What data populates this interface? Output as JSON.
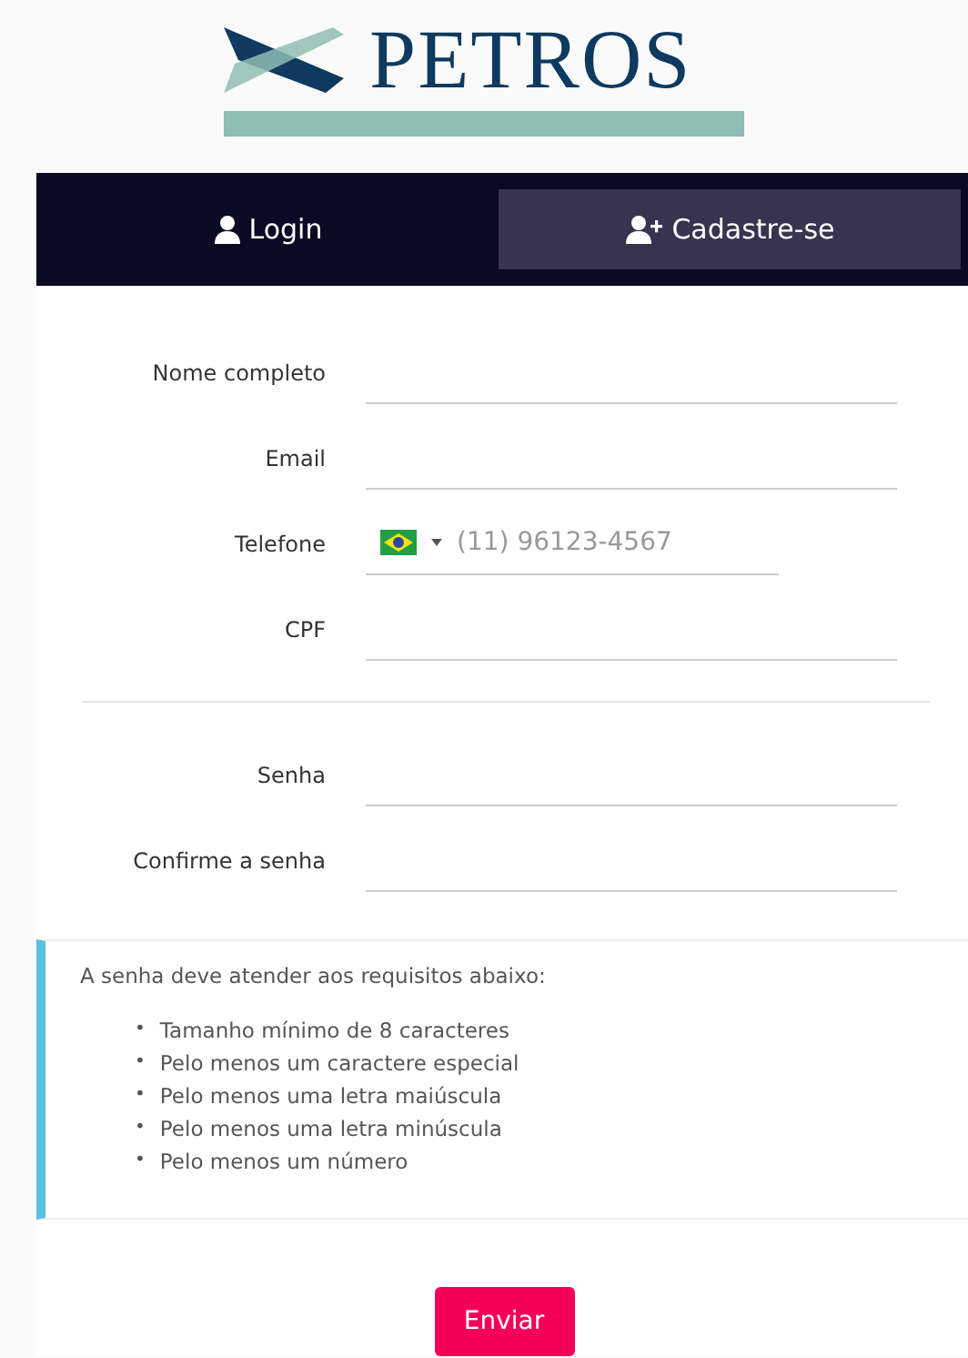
{
  "logo": {
    "text": "PETROS"
  },
  "tabs": [
    {
      "label": "Login",
      "kind": "login",
      "selected": false
    },
    {
      "label": "Cadastre-se",
      "kind": "register",
      "selected": true
    }
  ],
  "fields": [
    {
      "label": "Nome completo",
      "kind": "text"
    },
    {
      "label": "Email",
      "kind": "text"
    },
    {
      "label": "Telefone",
      "kind": "phone",
      "placeholder": "(11) 96123-4567"
    },
    {
      "label": "CPF",
      "kind": "text"
    },
    {
      "kind": "divider"
    },
    {
      "label": "Senha",
      "kind": "password"
    },
    {
      "label": "Confirme a senha",
      "kind": "password"
    }
  ],
  "requirements": {
    "bullet": "•",
    "title": "A senha deve atender aos requisitos abaixo:",
    "items": [
      "Tamanho mínimo de 8 caracteres",
      "Pelo menos um caractere especial",
      "Pelo menos uma letra maiúscula",
      "Pelo menos uma letra minúscula",
      "Pelo menos um número"
    ]
  },
  "submit": {
    "label": "Enviar"
  }
}
